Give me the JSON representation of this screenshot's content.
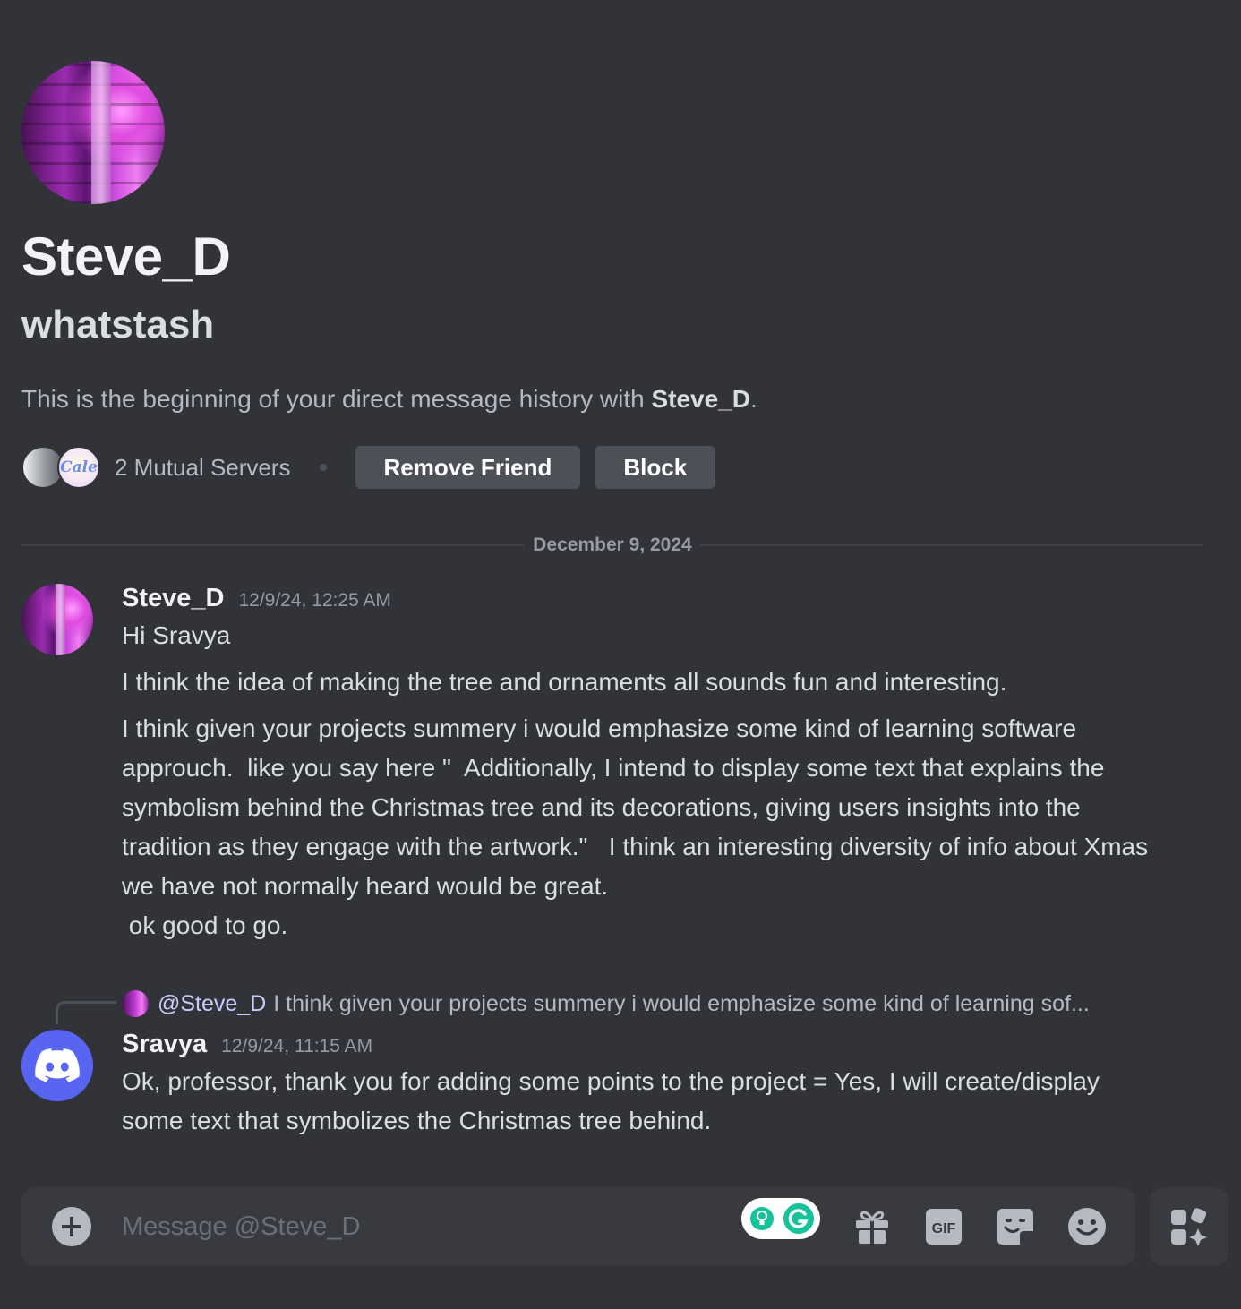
{
  "profile": {
    "display_name": "Steve_D",
    "username": "whatstash",
    "intro_prefix": "This is the beginning of your direct message history with ",
    "intro_name": "Steve_D",
    "intro_suffix": ".",
    "mutual_servers": "2 Mutual Servers",
    "server2_label": "Cale",
    "remove_friend_label": "Remove Friend",
    "block_label": "Block"
  },
  "date_divider": "December 9, 2024",
  "messages": [
    {
      "author": "Steve_D",
      "timestamp": "12/9/24, 12:25 AM",
      "lines": [
        "Hi Sravya",
        "I think the idea of making the tree and ornaments all sounds fun and interesting.",
        "I think given your projects summery i would emphasize some kind of learning software approuch.  like you say here \"  Additionally, I intend to display some text that explains the symbolism behind the Christmas tree and its decorations, giving users insights into the tradition as they engage with the artwork.\"   I think an interesting diversity of info about Xmas we have not normally heard would be great.\n ok good to go."
      ]
    },
    {
      "reply_to_name": "@Steve_D",
      "reply_to_text": "I think given your projects summery i would emphasize some kind of learning sof...",
      "author": "Sravya",
      "timestamp": "12/9/24, 11:15 AM",
      "lines": [
        "Ok, professor, thank you for adding some points to the project = Yes, I will create/display some text that symbolizes the Christmas tree behind."
      ]
    }
  ],
  "composer": {
    "placeholder": "Message @Steve_D"
  },
  "icons": {
    "add": "plus-circle-icon",
    "gift": "gift-icon",
    "gif": "gif-icon",
    "sticker": "sticker-icon",
    "emoji": "emoji-icon",
    "apps": "apps-icon",
    "grammarly": "grammarly-icon"
  },
  "colors": {
    "background": "#313338",
    "button": "#4e5058",
    "discord_blurple": "#5865f2",
    "mention": "#c9cdfb"
  }
}
